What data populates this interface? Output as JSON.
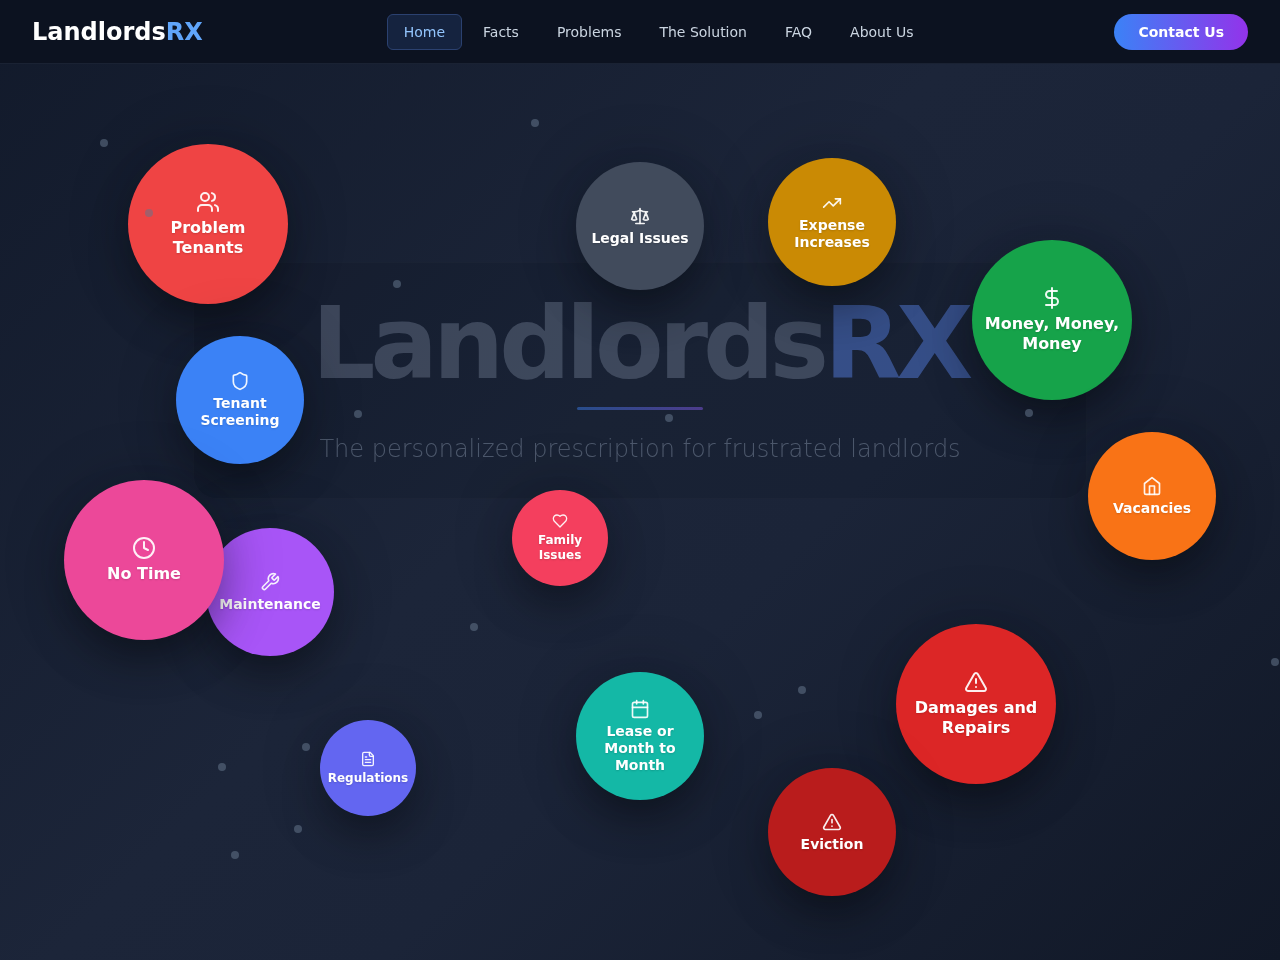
{
  "nav": {
    "logo": {
      "text": "Landlords",
      "accent": "RX"
    },
    "links": [
      {
        "label": "Home",
        "selected": true
      },
      {
        "label": "Facts",
        "selected": false
      },
      {
        "label": "Problems",
        "selected": false
      },
      {
        "label": "The Solution",
        "selected": false
      },
      {
        "label": "FAQ",
        "selected": false
      },
      {
        "label": "About Us",
        "selected": false
      }
    ],
    "cta": "Contact Us"
  },
  "hero": {
    "title": {
      "text": "Landlords",
      "accent": "RX"
    },
    "subtitle": "The personalized prescription for frustrated landlords"
  },
  "bubbles": [
    {
      "label": "Problem Tenants",
      "color": "#ef4444"
    },
    {
      "label": "Legal Issues",
      "color": "#414b5c"
    },
    {
      "label": "Money, Money, Money",
      "color": "#16a34a"
    },
    {
      "label": "Expense Increases",
      "color": "#ca8a04"
    },
    {
      "label": "Tenant Screening",
      "color": "#3b82f6"
    },
    {
      "label": "Family Issues",
      "color": "#f43f5e"
    },
    {
      "label": "Vacancies",
      "color": "#f97316"
    },
    {
      "label": "No Time",
      "color": "#ec4899"
    },
    {
      "label": "Maintenance",
      "color": "#a855f7"
    },
    {
      "label": "Damages and Repairs",
      "color": "#dc2626"
    },
    {
      "label": "Lease or Month to Month",
      "color": "#14b8a6"
    },
    {
      "label": "Regulations",
      "color": "#6366f1"
    },
    {
      "label": "Eviction",
      "color": "#b91c1c"
    }
  ]
}
